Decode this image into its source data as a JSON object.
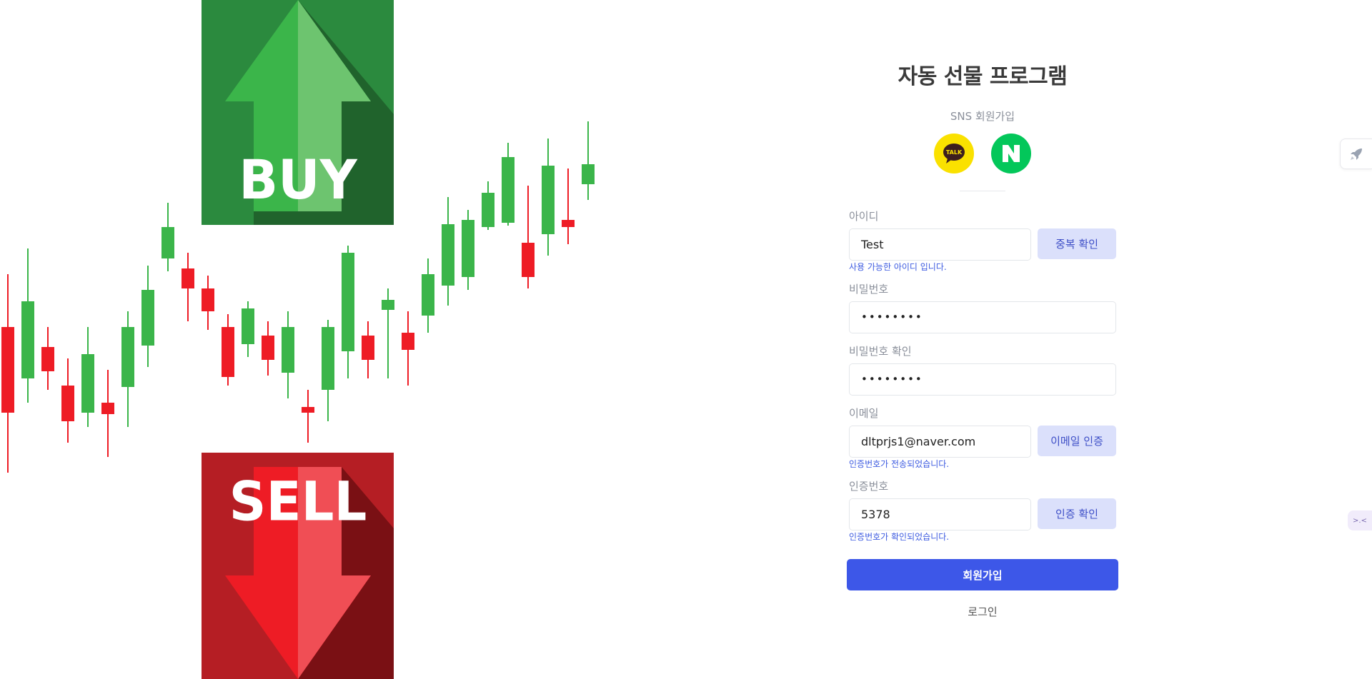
{
  "app": {
    "title": "자동 선물 프로그램"
  },
  "illustration": {
    "buy_label": "BUY",
    "sell_label": "SELL",
    "colors": {
      "up": "#3bb54a",
      "down": "#ee1c25",
      "buy_bg": "#2b8a3e",
      "sell_bg": "#b51e24"
    }
  },
  "sns": {
    "label": "SNS 회원가입",
    "kakao_text": "TALK",
    "naver_text": "N"
  },
  "form": {
    "id": {
      "label": "아이디",
      "value": "Test",
      "button": "중복 확인",
      "hint": "사용 가능한 아이디 입니다."
    },
    "password": {
      "label": "비밀번호",
      "value": "••••••••"
    },
    "password_confirm": {
      "label": "비밀번호 확인",
      "value": "••••••••"
    },
    "email": {
      "label": "이메일",
      "value": "dltprjs1@naver.com",
      "button": "이메일 인증",
      "hint": "인증번호가 전송되었습니다."
    },
    "code": {
      "label": "인증번호",
      "value": "5378",
      "button": "인증 확인",
      "hint": "인증번호가 확인되었습니다."
    },
    "submit_label": "회원가입",
    "login_label": "로그인"
  },
  "floating": {
    "chat_text": ">.<"
  },
  "colors": {
    "primary": "#3d57e8",
    "secondary_btn_bg": "#dbe0fb",
    "hint": "#3d5be0"
  }
}
